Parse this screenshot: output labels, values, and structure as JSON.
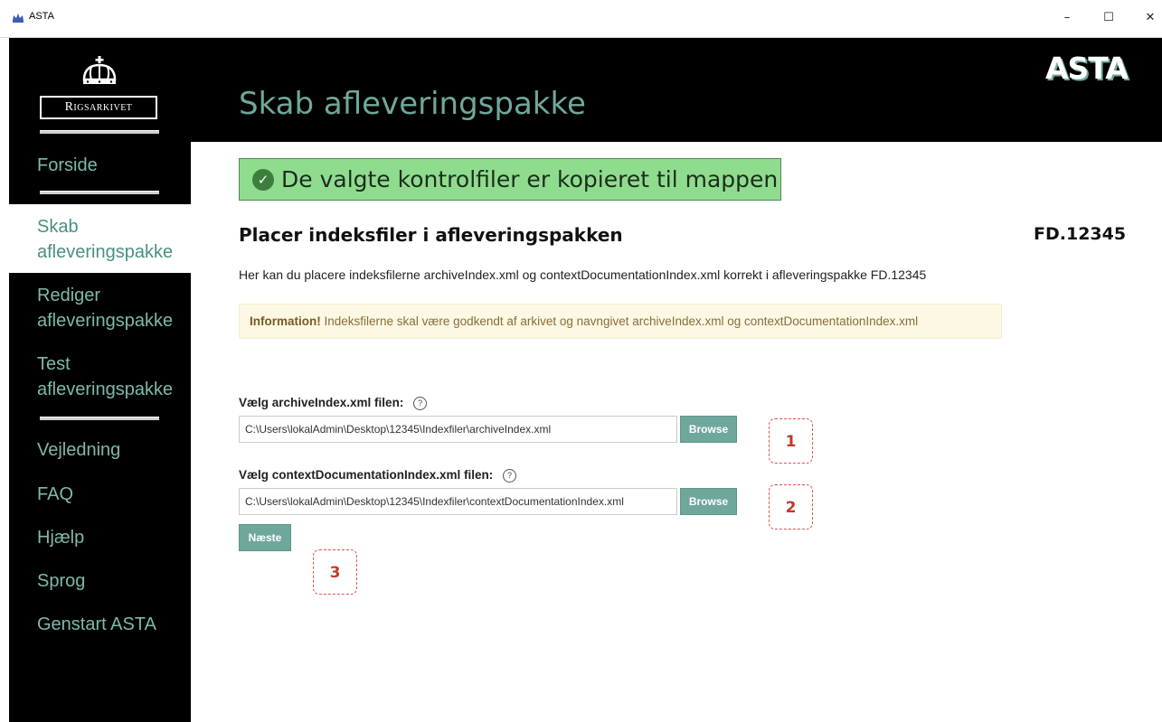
{
  "window": {
    "title": "ASTA",
    "minimize_glyph": "–",
    "maximize_glyph": "☐",
    "close_glyph": "✕"
  },
  "brand": {
    "logo_text": "Rigsarkivet",
    "app_logo": "ASTA"
  },
  "sidebar": {
    "items": [
      {
        "label": "Forside"
      },
      {
        "label": "Skab afleveringspakke"
      },
      {
        "label": "Rediger afleveringspakke"
      },
      {
        "label": "Test afleveringspakke"
      },
      {
        "label": "Vejledning"
      },
      {
        "label": "FAQ"
      },
      {
        "label": "Hjælp"
      },
      {
        "label": "Sprog"
      },
      {
        "label": "Genstart ASTA"
      }
    ],
    "active_index": 1
  },
  "header": {
    "title": "Skab afleveringspakke"
  },
  "main": {
    "success_message": "De valgte kontrolfiler er kopieret til mappen",
    "section_title": "Placer indeksfiler i afleveringspakken",
    "package_id": "FD.12345",
    "description": "Her kan du placere indeksfilerne archiveIndex.xml og contextDocumentationIndex.xml korrekt i afleveringspakke FD.12345",
    "info_strong": "Information!",
    "info_text": "Indeksfilerne skal være godkendt af arkivet og navngivet archiveIndex.xml og contextDocumentationIndex.xml",
    "archive_label": "Vælg archiveIndex.xml filen:",
    "archive_path": "C:\\Users\\lokalAdmin\\Desktop\\12345\\Indexfiler\\archiveIndex.xml",
    "context_label": "Vælg contextDocumentationIndex.xml filen:",
    "context_path": "C:\\Users\\lokalAdmin\\Desktop\\12345\\Indexfiler\\contextDocumentationIndex.xml",
    "browse_label": "Browse",
    "next_label": "Næste",
    "help_glyph": "?"
  },
  "markers": [
    "1",
    "2",
    "3"
  ],
  "colors": {
    "accent": "#6fa79c",
    "success_bg": "#8fdc8f",
    "info_bg": "#fcf8e3",
    "marker": "#d9534f"
  }
}
